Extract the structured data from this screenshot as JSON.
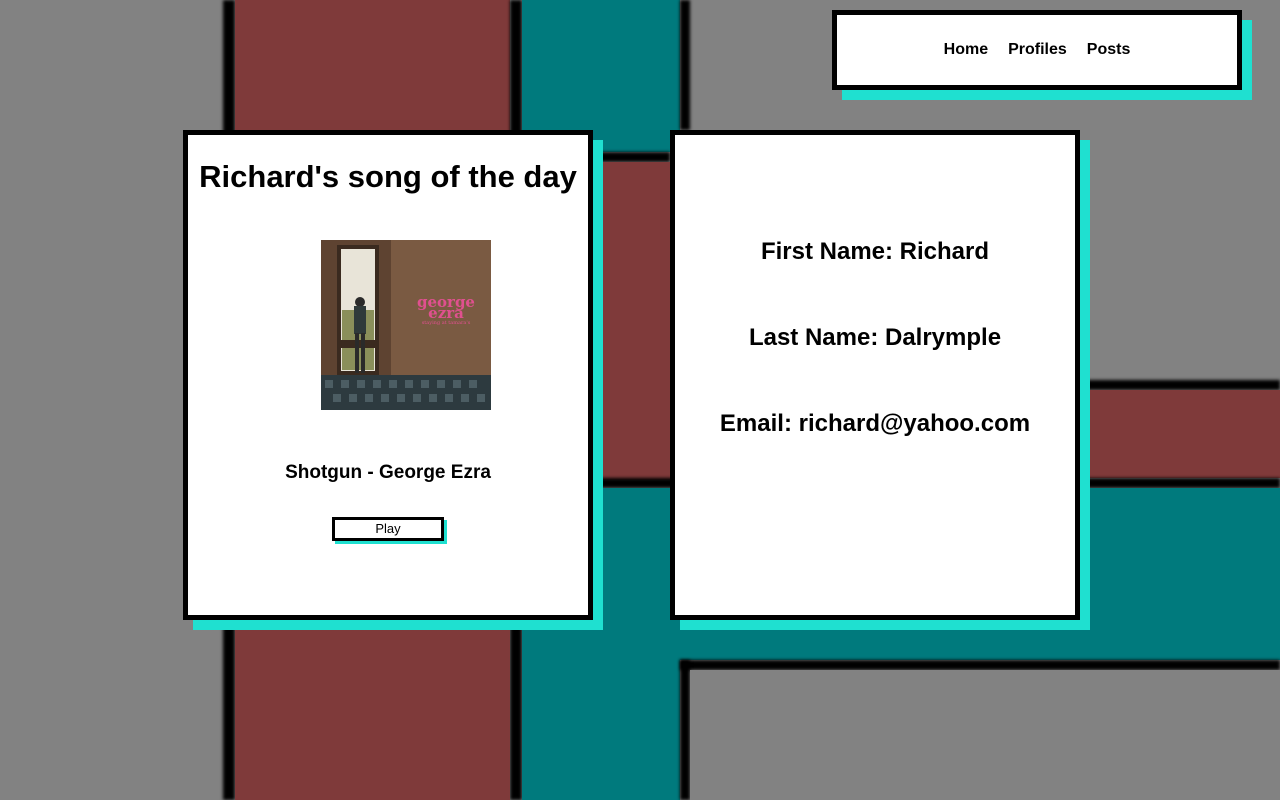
{
  "nav": {
    "items": [
      {
        "label": "Home"
      },
      {
        "label": "Profiles"
      },
      {
        "label": "Posts"
      }
    ]
  },
  "song_card": {
    "title": "Richard's song of the day",
    "album_art": {
      "artist_text_line1": "george",
      "artist_text_line2": "ezra",
      "album_text": "staying at tamara's"
    },
    "song": "Shotgun - George Ezra",
    "play_label": "Play"
  },
  "profile_card": {
    "first_name": "First Name: Richard",
    "last_name": "Last Name: Dalrymple",
    "email": "Email: richard@yahoo.com"
  },
  "colors": {
    "accent_shadow": "#1fe0d0",
    "bg_red": "#7f3a3a",
    "bg_teal": "#007a7d",
    "bg_gray": "#828282"
  }
}
